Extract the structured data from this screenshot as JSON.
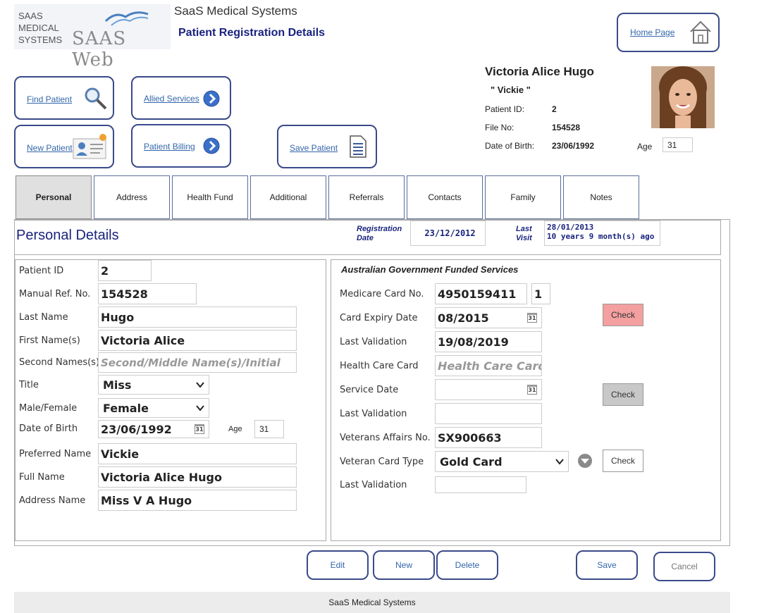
{
  "header": {
    "logo_text": [
      "SAAS",
      "MEDICAL",
      "SYSTEMS"
    ],
    "logo_web": "SAAS Web",
    "app_title": "SaaS Medical Systems",
    "page_title": "Patient Registration Details",
    "home_link": "Home Page"
  },
  "nav": {
    "find_patient": "Find Patient",
    "allied_services": "Allied Services",
    "new_patient": "New Patient",
    "patient_billing": "Patient Billing",
    "save_patient": "Save Patient"
  },
  "summary": {
    "name": "Victoria Alice Hugo",
    "nickname": "\" Vickie \"",
    "patient_id_label": "Patient ID:",
    "patient_id": "2",
    "file_no_label": "File No:",
    "file_no": "154528",
    "dob_label": "Date of Birth:",
    "dob": "23/06/1992",
    "age_label": "Age",
    "age": "31"
  },
  "tabs": [
    "Personal",
    "Address",
    "Health Fund",
    "Additional",
    "Referrals",
    "Contacts",
    "Family",
    "Notes"
  ],
  "section": {
    "title": "Personal Details",
    "reg_date_label": [
      "Registration",
      "Date"
    ],
    "reg_date": "23/12/2012",
    "last_visit_label": [
      "Last",
      "Visit"
    ],
    "last_visit": [
      "28/01/2013",
      "10 years 9 month(s) ago"
    ]
  },
  "personal": {
    "patient_id_label": "Patient ID",
    "patient_id": "2",
    "manual_ref_label": "Manual Ref. No.",
    "manual_ref": "154528",
    "last_name_label": "Last Name",
    "last_name": "Hugo",
    "first_names_label": "First Name(s)",
    "first_names": "Victoria Alice",
    "second_names_label": "Second Names(s)",
    "second_names_placeholder": "Second/Middle Name(s)/Initial",
    "title_label": "Title",
    "title": "Miss",
    "gender_label": "Male/Female",
    "gender": "Female",
    "dob_label": "Date of Birth",
    "dob": "23/06/1992",
    "age_label": "Age",
    "age": "31",
    "preferred_label": "Preferred Name",
    "preferred": "Vickie",
    "full_name_label": "Full Name",
    "full_name": "Victoria Alice Hugo",
    "address_name_label": "Address Name",
    "address_name": "Miss V A Hugo"
  },
  "gov": {
    "title": "Australian Government Funded Services",
    "medicare_label": "Medicare Card No.",
    "medicare": "4950159411",
    "medicare_irn": "1",
    "expiry_label": "Card Expiry Date",
    "expiry": "08/2015",
    "last_validation_label": "Last Validation",
    "last_validation": "19/08/2019",
    "hcc_label": "Health Care Card",
    "hcc_placeholder": "Health Care Card",
    "service_date_label": "Service Date",
    "last_validation2_label": "Last Validation",
    "dva_label": "Veterans Affairs No.",
    "dva": "SX900663",
    "vct_label": "Veteran Card Type",
    "vct": "Gold Card",
    "last_validation3_label": "Last Validation",
    "check_label": "Check"
  },
  "buttons": {
    "edit": "Edit",
    "new": "New",
    "delete": "Delete",
    "save": "Save",
    "cancel": "Cancel"
  },
  "footer": "SaaS Medical Systems",
  "colors": {
    "accent": "#3a4a8a",
    "title_blue": "#1a237e",
    "check_red": "#f4a0a0",
    "check_grey": "#c8c8c8"
  }
}
